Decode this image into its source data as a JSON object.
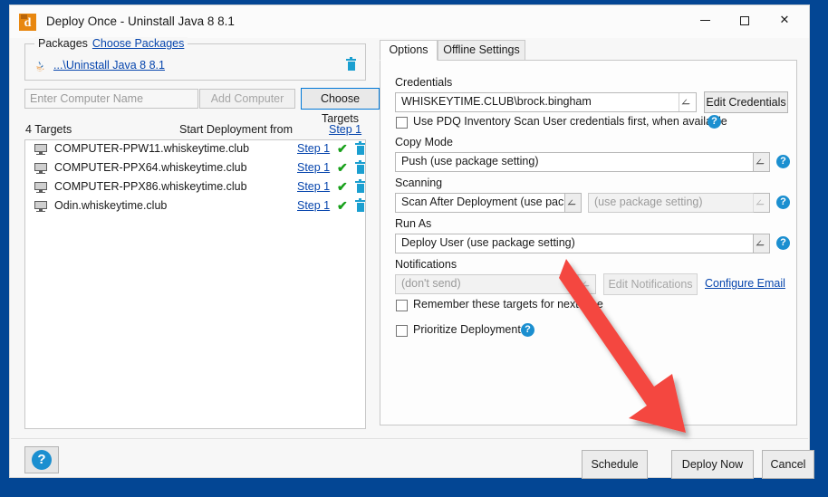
{
  "window": {
    "title": "Deploy Once - Uninstall Java 8 8.1",
    "app_icon": "pdq-deploy-icon",
    "minimize": "—",
    "maximize": "□",
    "close": "✕"
  },
  "packages": {
    "legend_label": "Packages",
    "choose_link": "Choose Packages",
    "item_name": "...\\Uninstall Java 8 8.1",
    "item_icon": "java-package-icon",
    "delete_icon": "trash-icon"
  },
  "targets": {
    "name_input_placeholder": "Enter Computer Name",
    "name_input_value": "",
    "add_computer_label": "Add Computer",
    "choose_targets_label": "Choose Targets",
    "count_label": "4 Targets",
    "start_from_label": "Start Deployment from",
    "start_from_value": "Step 1",
    "rows": [
      {
        "name": "COMPUTER-PPW11.whiskeytime.club",
        "step": "Step 1",
        "check": "✔"
      },
      {
        "name": "COMPUTER-PPX64.whiskeytime.club",
        "step": "Step 1",
        "check": "✔"
      },
      {
        "name": "COMPUTER-PPX86.whiskeytime.club",
        "step": "Step 1",
        "check": "✔"
      },
      {
        "name": "Odin.whiskeytime.club",
        "step": "Step 1",
        "check": "✔"
      }
    ]
  },
  "help_button": {
    "glyph": "?"
  },
  "tabs": {
    "options": "Options",
    "offline": "Offline Settings"
  },
  "options": {
    "credentials_label": "Credentials",
    "credentials_value": "WHISKEYTIME.CLUB\\brock.bingham",
    "edit_credentials_label": "Edit Credentials",
    "scan_user_checkbox_label": "Use PDQ Inventory Scan User credentials first, when available",
    "copy_mode_label": "Copy Mode",
    "copy_mode_value": "Push (use package setting)",
    "scanning_label": "Scanning",
    "scanning_value": "Scan After Deployment (use pac...",
    "scan_profile_value": "(use package setting)",
    "run_as_label": "Run As",
    "run_as_value": "Deploy User (use package setting)",
    "notifications_label": "Notifications",
    "notifications_value": "(don't send)",
    "edit_notifications_label": "Edit Notifications",
    "configure_email_label": "Configure Email",
    "remember_targets_label": "Remember these targets for next time",
    "prioritize_label": "Prioritize Deployment",
    "help_glyph": "?"
  },
  "footer": {
    "schedule_label": "Schedule",
    "deploy_now_label": "Deploy Now",
    "cancel_label": "Cancel"
  },
  "annotation": {
    "arrow_color": "#f4473f",
    "arrow_from": "625,285",
    "arrow_to": "757,478"
  },
  "colors": {
    "desktop_background": "#034694",
    "accent_link": "#0645ad",
    "help_blue": "#1b8fd0",
    "success_green": "#17a01a",
    "focus_blue": "#0078d7",
    "app_orange": "#e8870f"
  }
}
